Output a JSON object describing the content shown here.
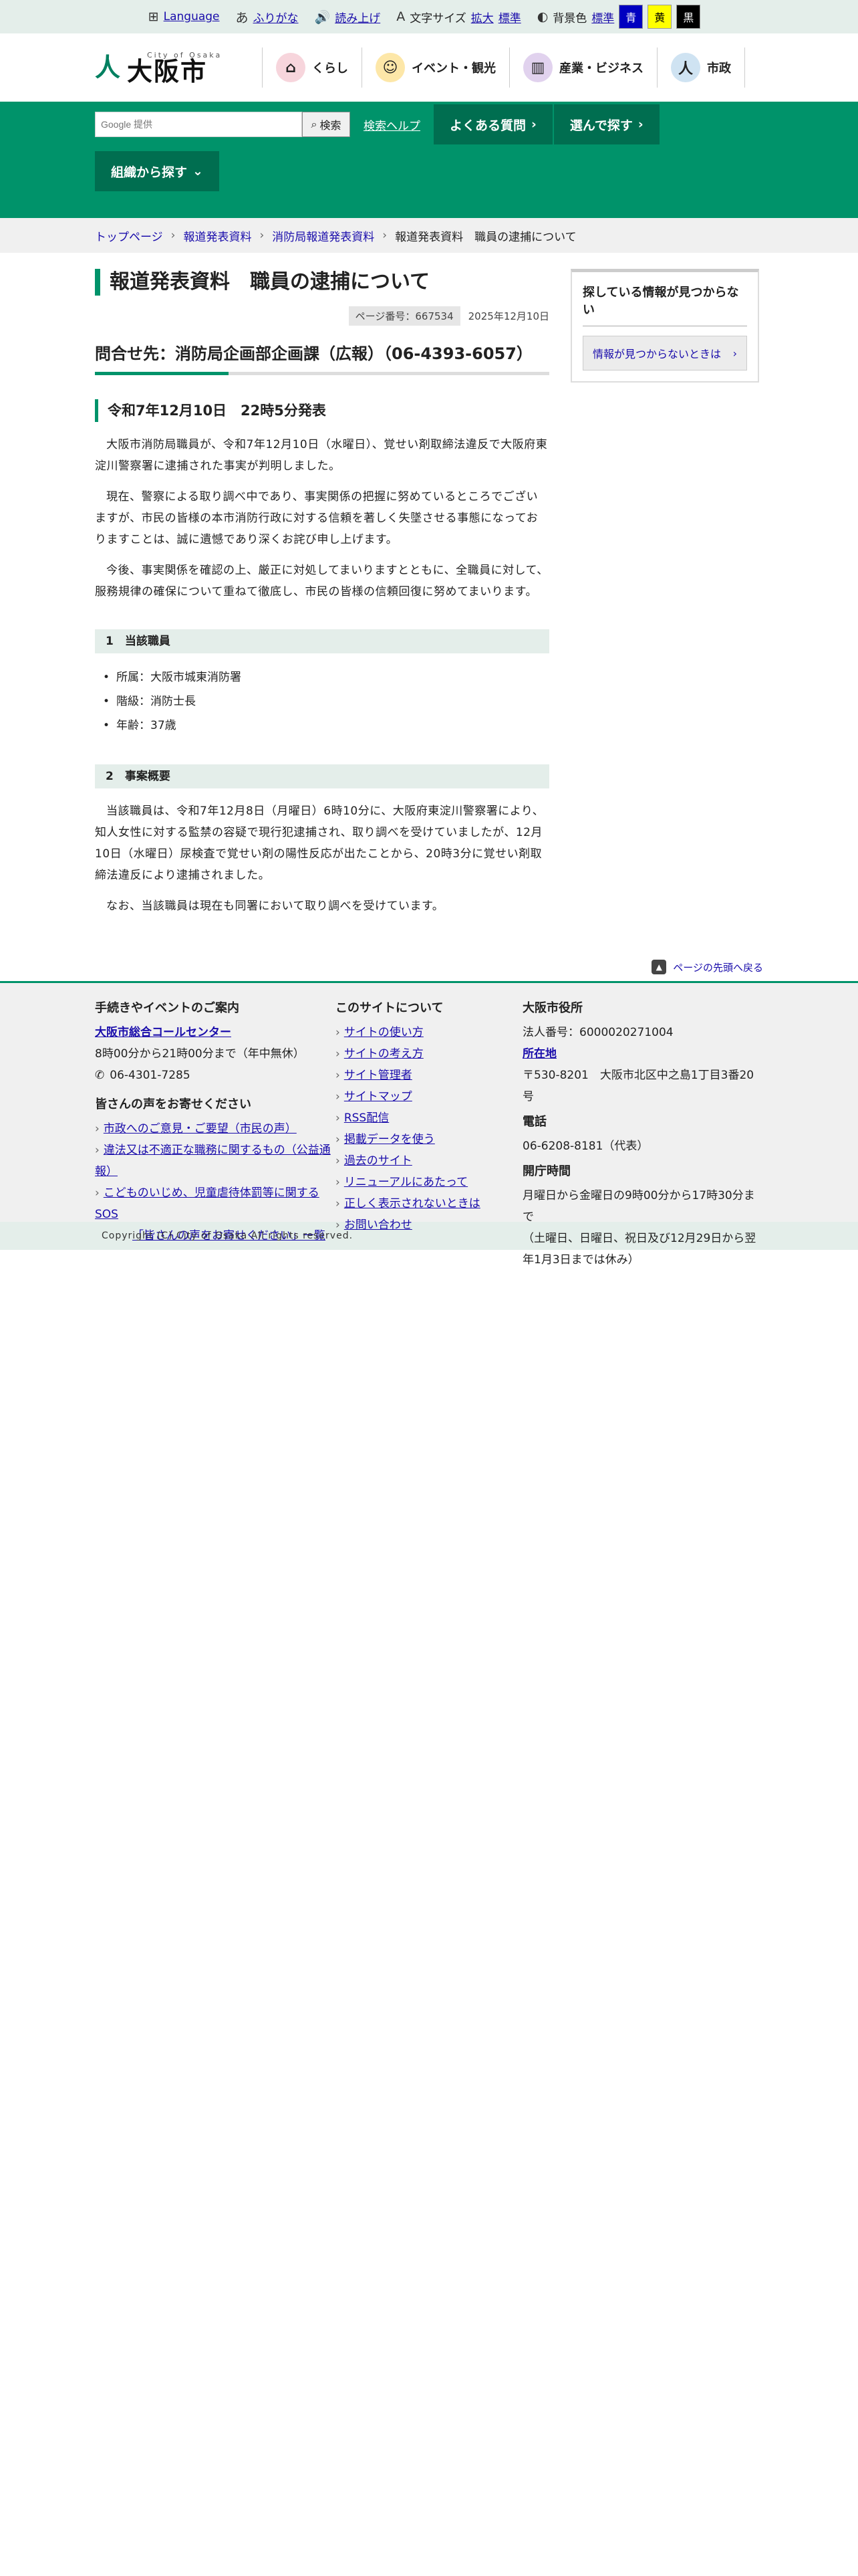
{
  "topbar": {
    "language": "Language",
    "furigana": "ふりがな",
    "read": "読み上げ",
    "fontsize_label": "文字サイズ",
    "enlarge": "拡大",
    "standard": "標準",
    "bg_label": "背景色",
    "bg_standard": "標準",
    "bg_blue": "青",
    "bg_yellow": "黄",
    "bg_black": "黒"
  },
  "logo": {
    "sub": "City of Osaka",
    "main": "大阪市"
  },
  "gnav": [
    "くらし",
    "イベント・観光",
    "産業・ビジネス",
    "市政"
  ],
  "search": {
    "placeholder": "Google 提供",
    "button": "検索",
    "help": "検索ヘルプ"
  },
  "nav": {
    "faq": "よくある質問",
    "choose": "選んで探す",
    "org": "組織から探す"
  },
  "breadcrumbs": [
    "トップページ",
    "報道発表資料",
    "消防局報道発表資料",
    "報道発表資料　職員の逮捕について"
  ],
  "article": {
    "title": "報道発表資料　職員の逮捕について",
    "page_no": "ページ番号：667534",
    "date": "2025年12月10日",
    "contact": "問合せ先：消防局企画部企画課（広報）（06-4393-6057）",
    "issued": "令和7年12月10日　22時5分発表",
    "paras": [
      "大阪市消防局職員が、令和7年12月10日（水曜日）、覚せい剤取締法違反で大阪府東淀川警察署に逮捕された事実が判明しました。",
      "現在、警察による取り調べ中であり、事実関係の把握に努めているところでございますが、市民の皆様の本市消防行政に対する信頼を著しく失墜させる事態になっておりますことは、誠に遺憾であり深くお詫び申し上げます。",
      "今後、事実関係を確認の上、厳正に対処してまいりますとともに、全職員に対して、服務規律の確保について重ねて徹底し、市民の皆様の信頼回復に努めてまいります。"
    ],
    "sec1_title": "1　当該職員",
    "sec1_items": [
      "所属：大阪市城東消防署",
      "階級：消防士長",
      "年齢：37歳"
    ],
    "sec2_title": "2　事案概要",
    "sec2_paras": [
      "当該職員は、令和7年12月8日（月曜日）6時10分に、大阪府東淀川警察署により、知人女性に対する監禁の容疑で現行犯逮捕され、取り調べを受けていましたが、12月10日（水曜日）尿検査で覚せい剤の陽性反応が出たことから、20時3分に覚せい剤取締法違反により逮捕されました。",
      "なお、当該職員は現在も同署において取り調べを受けています。"
    ]
  },
  "side": {
    "title": "探している情報が見つからない",
    "button": "情報が見つからないときは"
  },
  "totop": "ページの先頭へ戻る",
  "footer": {
    "col1": {
      "title": "手続きやイベントのご案内",
      "center": "大阪市総合コールセンター",
      "hours": "8時00分から21時00分まで（年中無休）",
      "tel": "06-4301-7285",
      "voice_title": "皆さんの声をお寄せください",
      "links": [
        "市政へのご意見・ご要望（市民の声）",
        "違法又は不適正な職務に関するもの（公益通報）",
        "こどものいじめ、児童虐待体罰等に関するSOS"
      ],
      "list": "「皆さんの声をお寄せください」一覧"
    },
    "col2": {
      "title": "このサイトについて",
      "links": [
        "サイトの使い方",
        "サイトの考え方",
        "サイト管理者",
        "サイトマップ",
        "RSS配信",
        "掲載データを使う",
        "過去のサイト",
        "リニューアルにあたって",
        "正しく表示されないときは",
        "お問い合わせ"
      ]
    },
    "col3": {
      "title": "大阪市役所",
      "corp": "法人番号：6000020271004",
      "loc_label": "所在地",
      "address": "〒530-8201　大阪市北区中之島1丁目3番20号",
      "tel_label": "電話",
      "tel": "06-6208-8181（代表）",
      "open_label": "開庁時間",
      "open": "月曜日から金曜日の9時00分から17時30分まで",
      "open_note": "（土曜日、日曜日、祝日及び12月29日から翌年1月3日までは休み）"
    }
  },
  "copyright": "Copyright (C) City of Osaka All rights reserved."
}
